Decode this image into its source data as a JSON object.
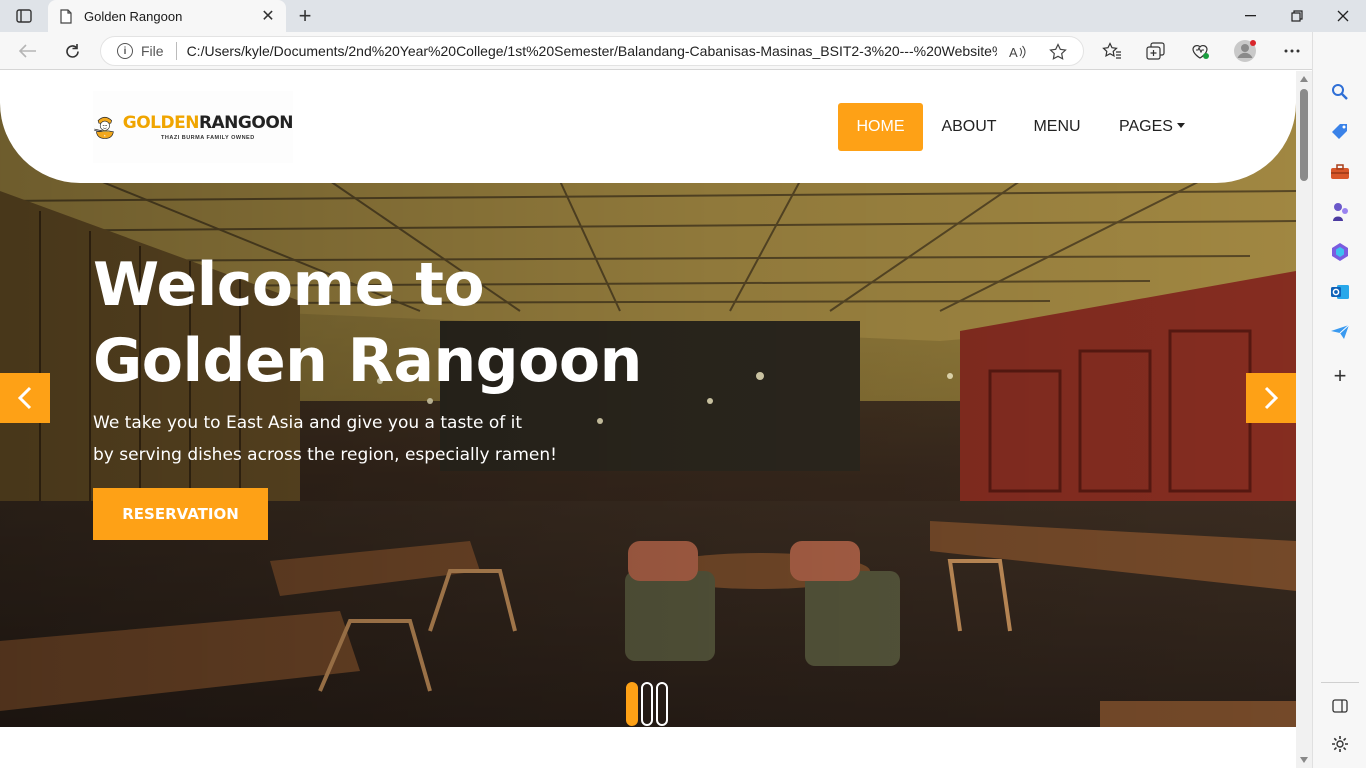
{
  "browser": {
    "tab_title": "Golden Rangoon",
    "url_scheme_label": "File",
    "url": "C:/Users/kyle/Documents/2nd%20Year%20College/1st%20Semester/Balandang-Cabanisas-Masinas_BSIT2-3%20---%20Website%..."
  },
  "site": {
    "logo": {
      "name_part1": "GOLDEN",
      "name_part2": "RANGOON",
      "tagline": "THAZI BURMA FAMILY OWNED"
    },
    "nav": {
      "home": "HOME",
      "about": "ABOUT",
      "menu": "MENU",
      "pages": "PAGES"
    },
    "hero": {
      "title_line1": "Welcome to",
      "title_line2": "Golden Rangoon",
      "subtitle_line1": "We take you to East Asia and give you a taste of it",
      "subtitle_line2": "by serving dishes across the region, especially ramen!",
      "cta": "RESERVATION"
    },
    "carousel": {
      "slide_count": 3,
      "active_index": 0
    }
  },
  "colors": {
    "accent": "#fea116",
    "logo_gold": "#f0a500"
  }
}
